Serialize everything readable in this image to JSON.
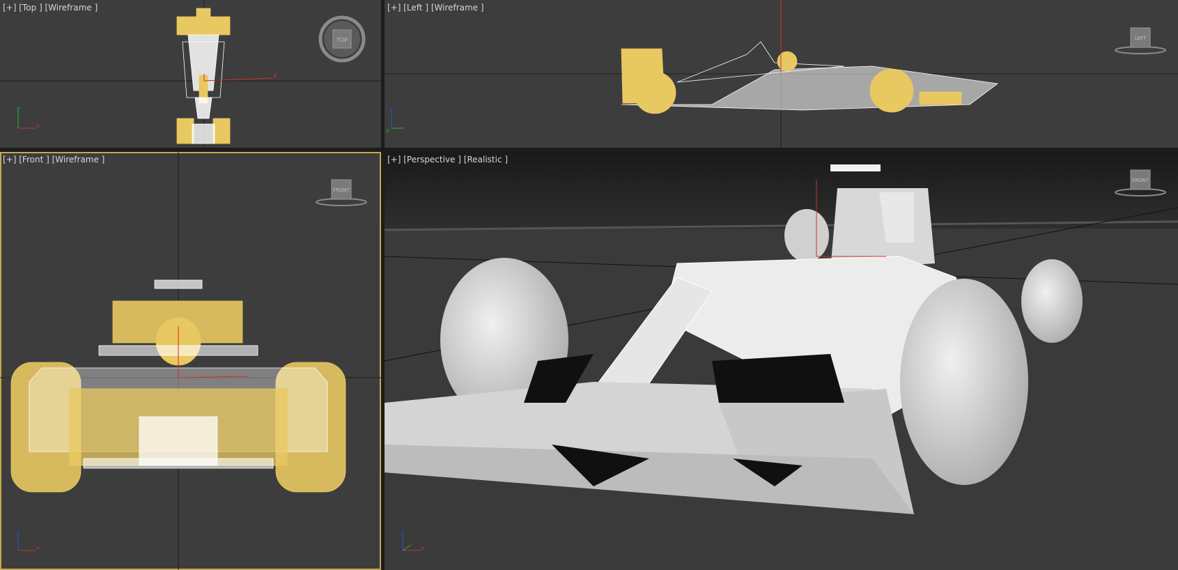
{
  "viewports": {
    "top": {
      "plus": "[+]",
      "view": "[Top ]",
      "shading": "[Wireframe ]",
      "cube_label": "TOP"
    },
    "left": {
      "plus": "[+]",
      "view": "[Left ]",
      "shading": "[Wireframe ]",
      "cube_label": "LEFT"
    },
    "front": {
      "plus": "[+]",
      "view": "[Front ]",
      "shading": "[Wireframe ]",
      "cube_label": "FRONT"
    },
    "perspective": {
      "plus": "[+]",
      "view": "[Perspective ]",
      "shading": "[Realistic ]",
      "cube_label": "FRONT"
    }
  },
  "axes": {
    "x": "x",
    "y": "y",
    "z": "z"
  },
  "colors": {
    "viewport_bg": "#3d3d3d",
    "selection": "#e8c860",
    "wire": "#ffffff",
    "active_border": "#c8a84b",
    "axis_x": "#d03030",
    "axis_y": "#30b030",
    "axis_z": "#3050d0"
  },
  "icons": [
    "viewcube-icon",
    "axis-tripod-icon",
    "transform-gizmo-icon"
  ]
}
